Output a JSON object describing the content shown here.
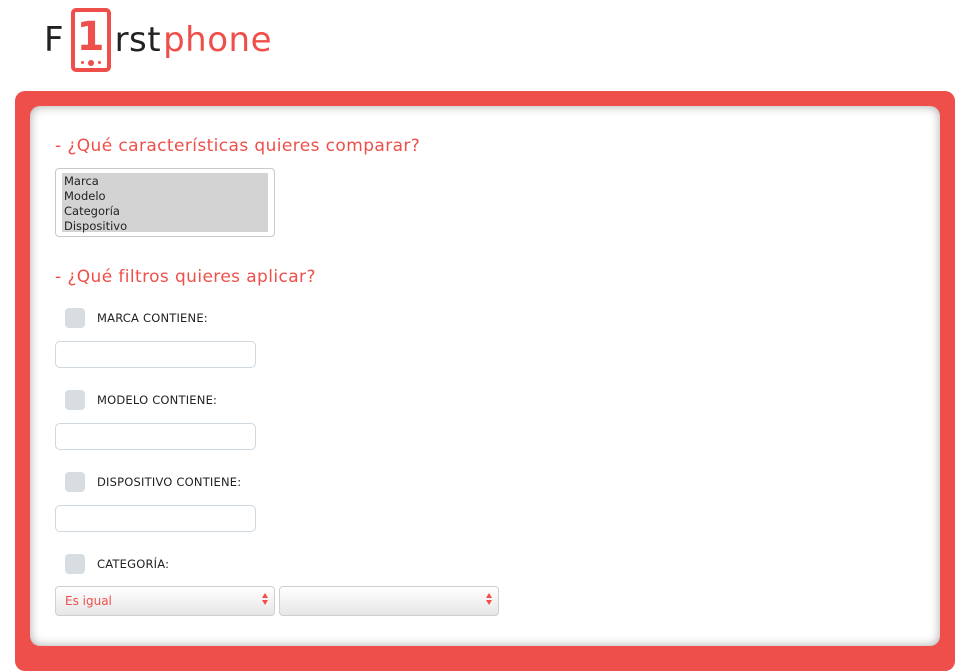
{
  "logo": {
    "prefix": "F",
    "digit": "1",
    "middle": "rst",
    "suffix": "phone"
  },
  "compare": {
    "title": "- ¿Qué características quieres comparar?",
    "options": [
      "Marca",
      "Modelo",
      "Categoría",
      "Dispositivo"
    ]
  },
  "filters": {
    "title": "- ¿Qué filtros quieres aplicar?",
    "marca_label": "MARCA CONTIENE:",
    "marca_value": "",
    "modelo_label": "MODELO CONTIENE:",
    "modelo_value": "",
    "dispositivo_label": "DISPOSITIVO CONTIENE:",
    "dispositivo_value": "",
    "categoria_label": "CATEGORÍA:",
    "categoria_operator": "Es igual",
    "categoria_value": ""
  },
  "colors": {
    "brand": "#ef4f4a",
    "checkbox": "#d8dde2",
    "selected_option": "#d3d3d3"
  }
}
